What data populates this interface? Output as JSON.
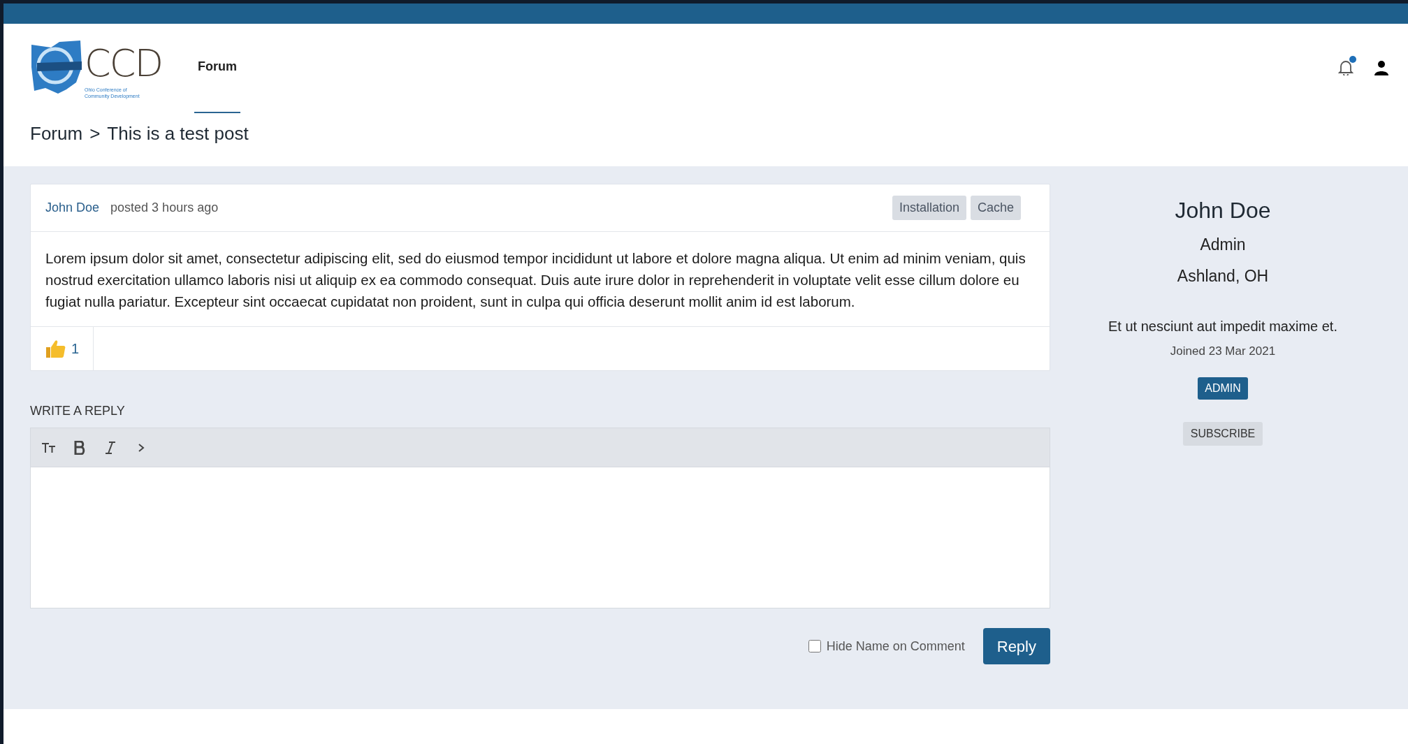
{
  "logo": {
    "letters": "CCD",
    "subtitle_lines": [
      "Ohio Conference of",
      "Community Development"
    ]
  },
  "nav": [
    {
      "label": "Forum",
      "selected": true
    }
  ],
  "notifications": {
    "unread": true
  },
  "breadcrumb": [
    "Forum",
    "This is a test post"
  ],
  "breadcrumb_separator": ">",
  "post": {
    "author": "John Doe",
    "meta": "posted 3 hours ago",
    "tags": [
      "Installation",
      "Cache"
    ],
    "body": "Lorem ipsum dolor sit amet, consectetur adipiscing elit, sed do eiusmod tempor incididunt ut labore et dolore magna aliqua. Ut enim ad minim veniam, quis nostrud exercitation ullamco laboris nisi ut aliquip ex ea commodo consequat. Duis aute irure dolor in reprehenderit in voluptate velit esse cillum dolore eu fugiat nulla pariatur. Excepteur sint occaecat cupidatat non proident, sunt in culpa qui officia deserunt mollit anim id est laborum.",
    "likes": "1"
  },
  "reply": {
    "heading": "WRITE A REPLY",
    "toolbar": [
      {
        "kind": "heading"
      },
      {
        "kind": "bold"
      },
      {
        "kind": "italic"
      },
      {
        "kind": "more"
      }
    ],
    "hide_name": {
      "label": "Hide Name on Comment",
      "checked": false
    },
    "submit": "Reply"
  },
  "profile": {
    "name": "John Doe",
    "role": "Admin",
    "location": "Ashland, OH",
    "bio": "Et ut nesciunt aut impedit maxime et.",
    "joined": "Joined 23 Mar 2021",
    "badge": "ADMIN",
    "subscribe": "SUBSCRIBE"
  }
}
